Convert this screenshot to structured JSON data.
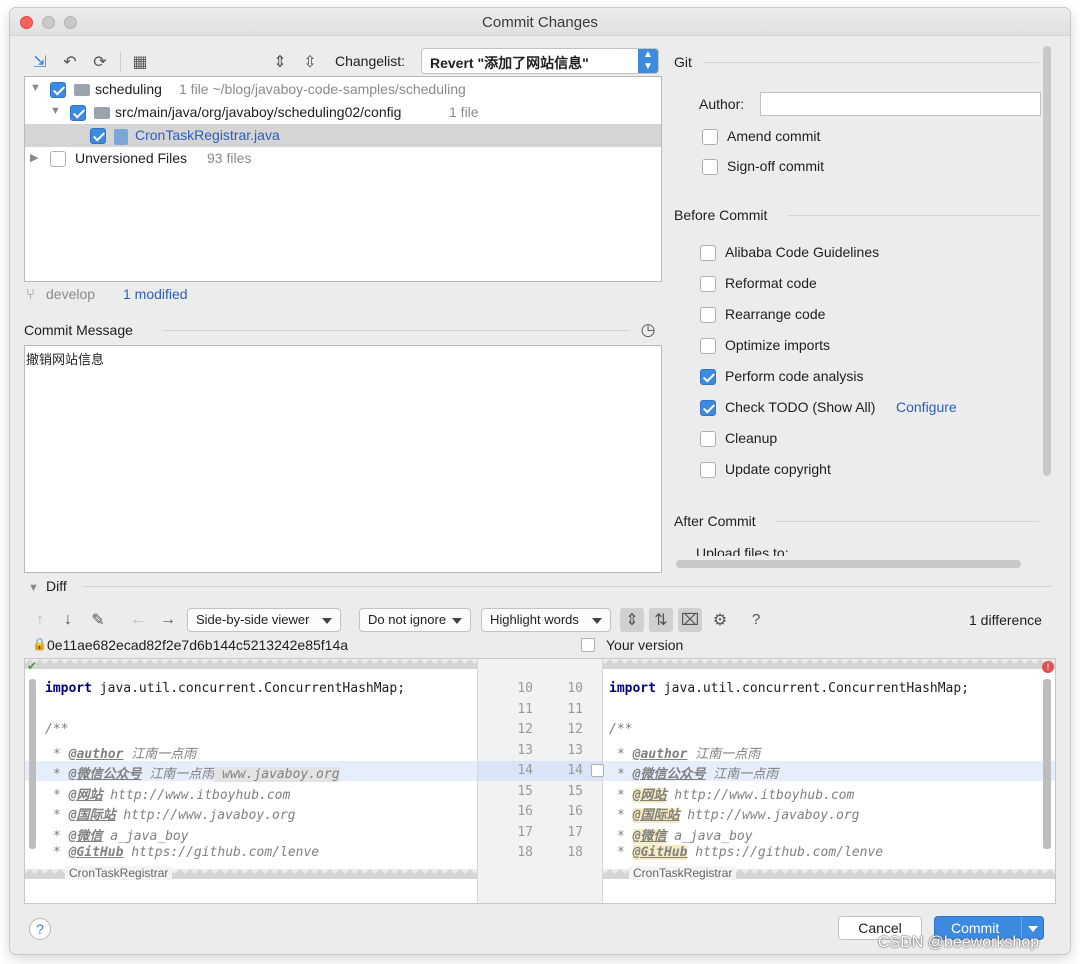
{
  "window": {
    "title": "Commit Changes"
  },
  "changelist": {
    "label": "Changelist:",
    "value": "Revert \"添加了网站信息\""
  },
  "tree": {
    "root": {
      "name": "scheduling",
      "meta": "1 file  ~/blog/javaboy-code-samples/scheduling"
    },
    "dir": {
      "name": "src/main/java/org/javaboy/scheduling02/config",
      "meta": "1 file"
    },
    "file": {
      "name": "CronTaskRegistrar.java"
    },
    "unversioned": {
      "name": "Unversioned Files",
      "meta": "93 files"
    }
  },
  "status": {
    "branch": "develop",
    "modified": "1 modified"
  },
  "commit_message": {
    "label": "Commit Message",
    "text": "撤销网站信息"
  },
  "git": {
    "title": "Git",
    "author_label": "Author:",
    "author_value": "",
    "amend": "Amend commit",
    "signoff": "Sign-off commit"
  },
  "before_commit": {
    "title": "Before Commit",
    "items": [
      {
        "label": "Alibaba Code Guidelines",
        "checked": false
      },
      {
        "label": "Reformat code",
        "checked": false
      },
      {
        "label": "Rearrange code",
        "checked": false
      },
      {
        "label": "Optimize imports",
        "checked": false
      },
      {
        "label": "Perform code analysis",
        "checked": true
      },
      {
        "label": "Check TODO (Show All)",
        "checked": true
      },
      {
        "label": "Cleanup",
        "checked": false
      },
      {
        "label": "Update copyright",
        "checked": false
      }
    ],
    "configure": "Configure"
  },
  "after_commit": {
    "title": "After Commit",
    "upload": "Upload files to:"
  },
  "diff": {
    "title": "Diff",
    "viewer": "Side-by-side viewer",
    "ignore": "Do not ignore",
    "highlight": "Highlight words",
    "help": "?",
    "count": "1 difference",
    "left_rev": "0e11ae682ecad82f2e7d6b144c5213242e85f14a",
    "right_rev": "Your version",
    "class_name": "CronTaskRegistrar",
    "left_numbers": [
      "10",
      "11",
      "12",
      "13",
      "14",
      "15",
      "16",
      "17",
      "18"
    ],
    "right_numbers": [
      "10",
      "11",
      "12",
      "13",
      "14",
      "15",
      "16",
      "17",
      "18"
    ],
    "lines": {
      "l0_kw": "import",
      "l0_rest": " java.util.concurrent.ConcurrentHashMap;",
      "l2": "/**",
      "l3_tag": "@author",
      "l3_rest": " 江南一点雨",
      "l4_tag": "@微信公众号",
      "l4_rest": " 江南一点雨",
      "l4_extra": " www.javaboy.org",
      "l5_tag": "@网站",
      "l5_rest": " http://www.itboyhub.com",
      "l6_tag": "@国际站",
      "l6_rest": " http://www.javaboy.org",
      "l7_tag": "@微信",
      "l7_rest": " a_java_boy",
      "l8_tag": "@GitHub",
      "l8_rest": " https://github.com/lenve"
    }
  },
  "buttons": {
    "cancel": "Cancel",
    "commit": "Commit",
    "help": "?"
  },
  "watermark": "CSDN @beeworkshop",
  "colors": {
    "accent": "#3d8be0",
    "selection": "#d5d5d5",
    "diff_changed": "#e6eefc"
  }
}
